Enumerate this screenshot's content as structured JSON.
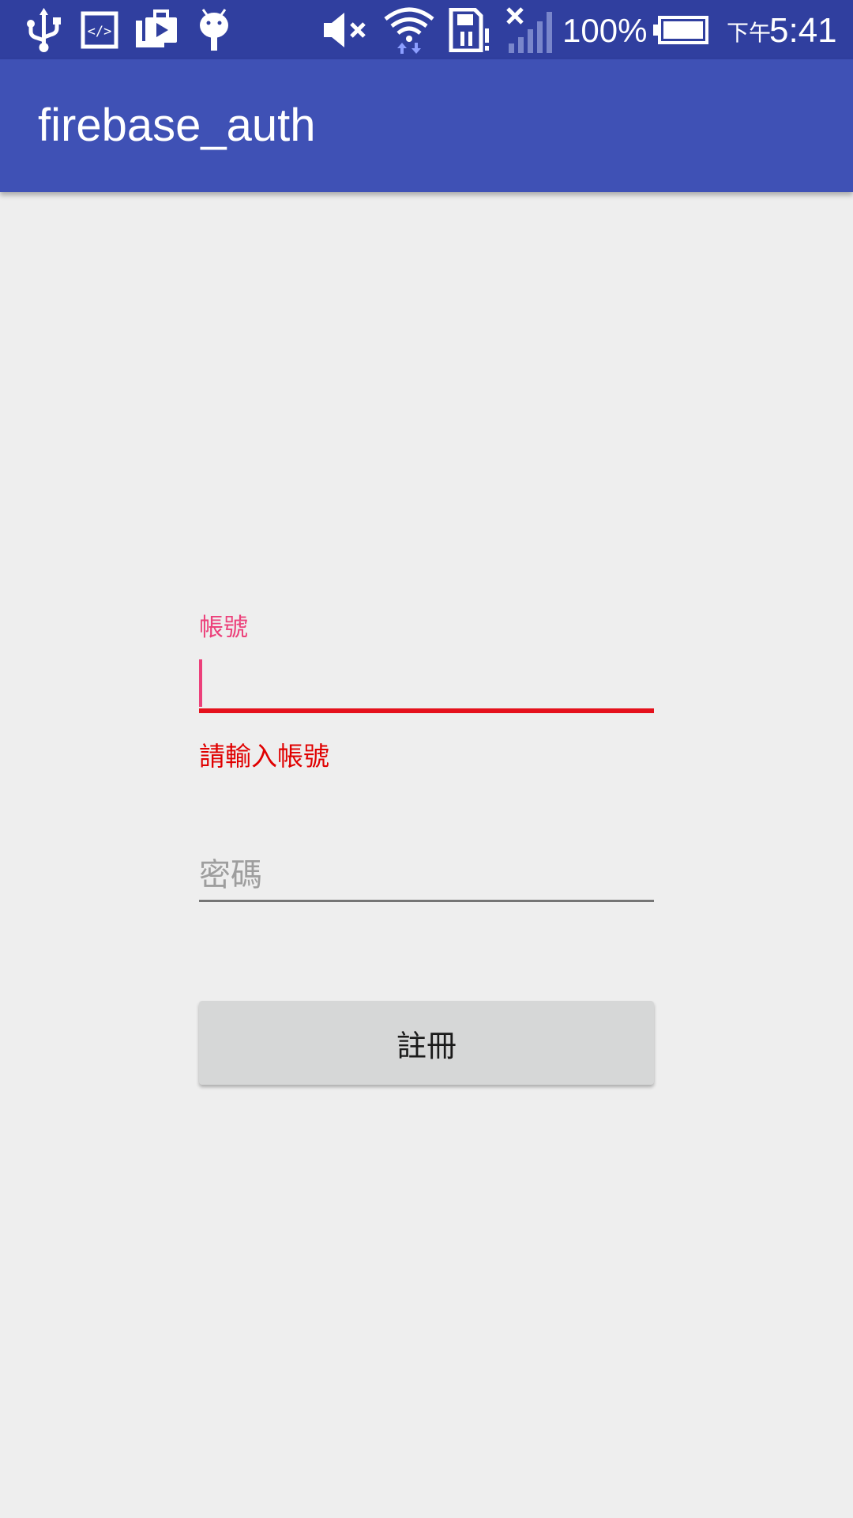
{
  "status_bar": {
    "left_icons": [
      "usb-icon",
      "developer-mode-icon",
      "play-store-icon",
      "android-debug-icon"
    ],
    "right_icons": [
      "volume-muted-icon",
      "wifi-icon",
      "sd-card-alert-icon",
      "signal-no-service-icon",
      "battery-icon"
    ],
    "battery_percent": "100%",
    "clock_prefix": "下午",
    "clock_time": "5:41"
  },
  "app_bar": {
    "title": "firebase_auth",
    "color": "#3f51b5"
  },
  "form": {
    "account": {
      "label": "帳號",
      "value": "",
      "error": "請輸入帳號",
      "label_color": "#ec407a",
      "error_color": "#e00000"
    },
    "password": {
      "placeholder": "密碼",
      "value": ""
    },
    "register_button": {
      "label": "註冊"
    }
  },
  "colors": {
    "status_bar": "#303f9f",
    "app_bar": "#3f51b5",
    "background": "#eeeeee",
    "accent": "#ec407a",
    "error": "#e5111c"
  }
}
